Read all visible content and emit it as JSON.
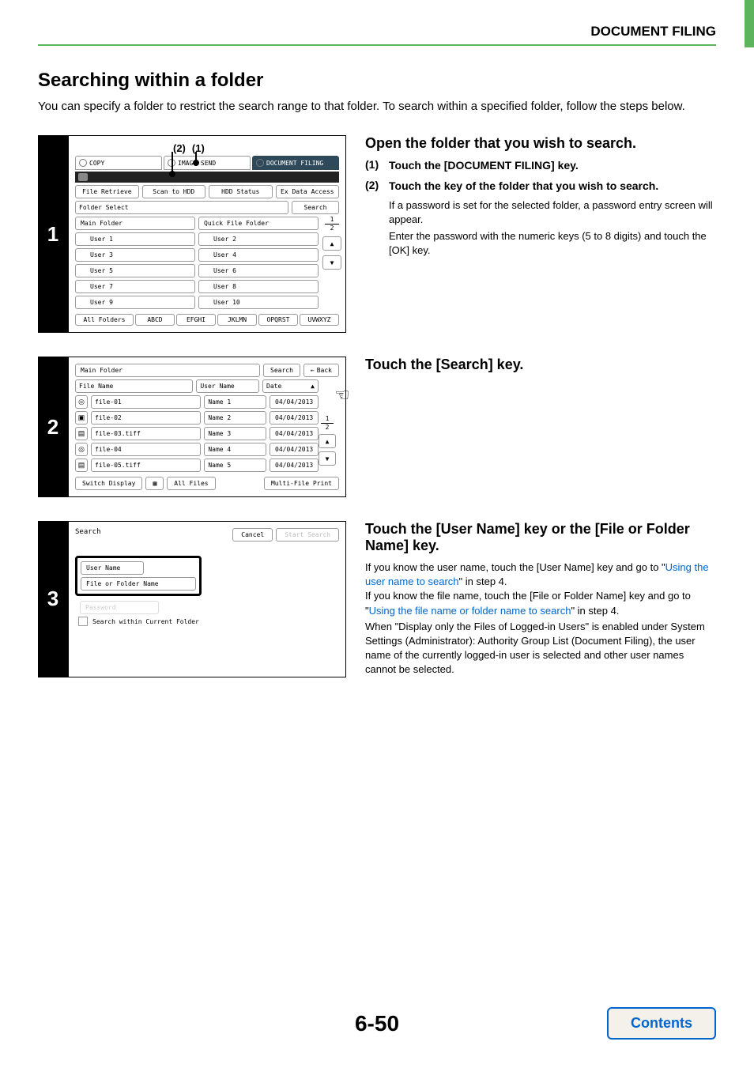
{
  "header": {
    "title": "DOCUMENT FILING"
  },
  "page": {
    "h2": "Searching within a folder",
    "intro": "You can specify a folder to restrict the search range to that folder. To search within a specified folder, follow the steps below."
  },
  "step1": {
    "num": "1",
    "callout2": "(2)",
    "callout1": "(1)",
    "tabs": {
      "copy": "COPY",
      "image": "IMAGE SEND",
      "docfiling": "DOCUMENT FILING"
    },
    "row": {
      "retrieve": "File Retrieve",
      "scan": "Scan to HDD",
      "hdd": "HDD Status",
      "ex": "Ex Data Access"
    },
    "folderSelect": "Folder Select",
    "search": "Search",
    "mainFolder": "Main Folder",
    "quick": "Quick File Folder",
    "users": [
      "User 1",
      "User 2",
      "User 3",
      "User 4",
      "User 5",
      "User 6",
      "User 7",
      "User 8",
      "User 9",
      "User 10"
    ],
    "frac": {
      "n": "1",
      "d": "2"
    },
    "alpha": [
      "All Folders",
      "ABCD",
      "EFGHI",
      "JKLMN",
      "OPQRST",
      "UVWXYZ"
    ],
    "title": "Open the folder that you wish to search.",
    "sub1num": "(1)",
    "sub1txt": "Touch the [DOCUMENT FILING] key.",
    "sub2num": "(2)",
    "sub2txt": "Touch the key of the folder that you wish to search.",
    "body1": "If a password is set for the selected folder, a password entry screen will appear.",
    "body2": "Enter the password with the numeric keys (5 to 8 digits) and touch the [OK] key."
  },
  "step2": {
    "num": "2",
    "title": "Touch the [Search] key.",
    "mainFolder": "Main Folder",
    "search": "Search",
    "back": "Back",
    "fileName": "File Name",
    "userName": "User Name",
    "date": "Date",
    "files": [
      {
        "icon": "c",
        "name": "file-01",
        "user": "Name 1",
        "date": "04/04/2013"
      },
      {
        "icon": "p",
        "name": "file-02",
        "user": "Name 2",
        "date": "04/04/2013"
      },
      {
        "icon": "s",
        "name": "file-03.tiff",
        "user": "Name 3",
        "date": "04/04/2013"
      },
      {
        "icon": "c",
        "name": "file-04",
        "user": "Name 4",
        "date": "04/04/2013"
      },
      {
        "icon": "s",
        "name": "file-05.tiff",
        "user": "Name 5",
        "date": "04/04/2013"
      }
    ],
    "frac": {
      "n": "1",
      "d": "2"
    },
    "switch": "Switch Display",
    "all": "All Files",
    "multi": "Multi-File Print"
  },
  "step3": {
    "num": "3",
    "panelTitle": "Search",
    "cancel": "Cancel",
    "start": "Start Search",
    "userName": "User Name",
    "fileFolder": "File or Folder Name",
    "password": "Password",
    "within": "Search within Current Folder",
    "title": "Touch the [User Name] key or the [File or Folder Name] key.",
    "b1a": "If you know the user name, touch the [User Name] key and go to \"",
    "b1link": "Using the user name to search",
    "b1b": "\" in step 4.",
    "b2a": "If you know the file name, touch the [File or Folder Name] key and go to \"",
    "b2link": "Using the file name or folder name to search",
    "b2b": "\" in step 4.",
    "b3": "When \"Display only the Files of Logged-in Users\" is enabled under System Settings (Administrator): Authority Group List (Document Filing), the user name of the currently logged-in user is selected and other user names cannot be selected."
  },
  "footer": {
    "page": "6-50",
    "contents": "Contents"
  }
}
